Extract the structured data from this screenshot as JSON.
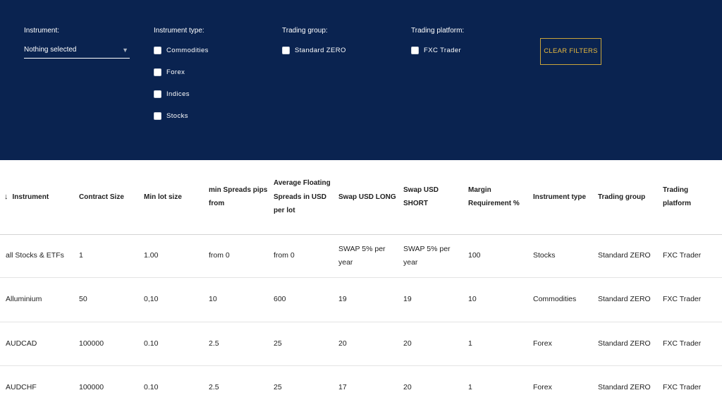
{
  "filters": {
    "instrument": {
      "title": "Instrument:",
      "selected": "Nothing selected"
    },
    "instrument_type": {
      "title": "Instrument type:",
      "options": [
        "Commodities",
        "Forex",
        "Indices",
        "Stocks"
      ]
    },
    "trading_group": {
      "title": "Trading group:",
      "options": [
        "Standard ZERO"
      ]
    },
    "trading_platform": {
      "title": "Trading platform:",
      "options": [
        "FXC Trader"
      ]
    },
    "clear_label": "CLEAR FILTERS"
  },
  "colors": {
    "header_bg": "#0a2350",
    "accent": "#e7b93f"
  },
  "table": {
    "sort_icon": "↓",
    "columns": [
      "Instrument",
      "Contract Size",
      "Min lot size",
      "min Spreads pips from",
      "Average Floating Spreads in USD per lot",
      "Swap USD LONG",
      "Swap USD SHORT",
      "Margin Requirement %",
      "Instrument type",
      "Trading group",
      "Trading platform"
    ],
    "rows": [
      [
        "all Stocks & ETFs",
        "1",
        "1.00",
        "from 0",
        "from 0",
        "SWAP 5% per year",
        "SWAP 5% per year",
        "100",
        "Stocks",
        "Standard ZERO",
        "FXC Trader"
      ],
      [
        "Alluminium",
        "50",
        "0,10",
        "10",
        "600",
        "19",
        "19",
        "10",
        "Commodities",
        "Standard ZERO",
        "FXC Trader"
      ],
      [
        "AUDCAD",
        "100000",
        "0.10",
        "2.5",
        "25",
        "20",
        "20",
        "1",
        "Forex",
        "Standard ZERO",
        "FXC Trader"
      ],
      [
        "AUDCHF",
        "100000",
        "0.10",
        "2.5",
        "25",
        "17",
        "20",
        "1",
        "Forex",
        "Standard ZERO",
        "FXC Trader"
      ]
    ]
  }
}
